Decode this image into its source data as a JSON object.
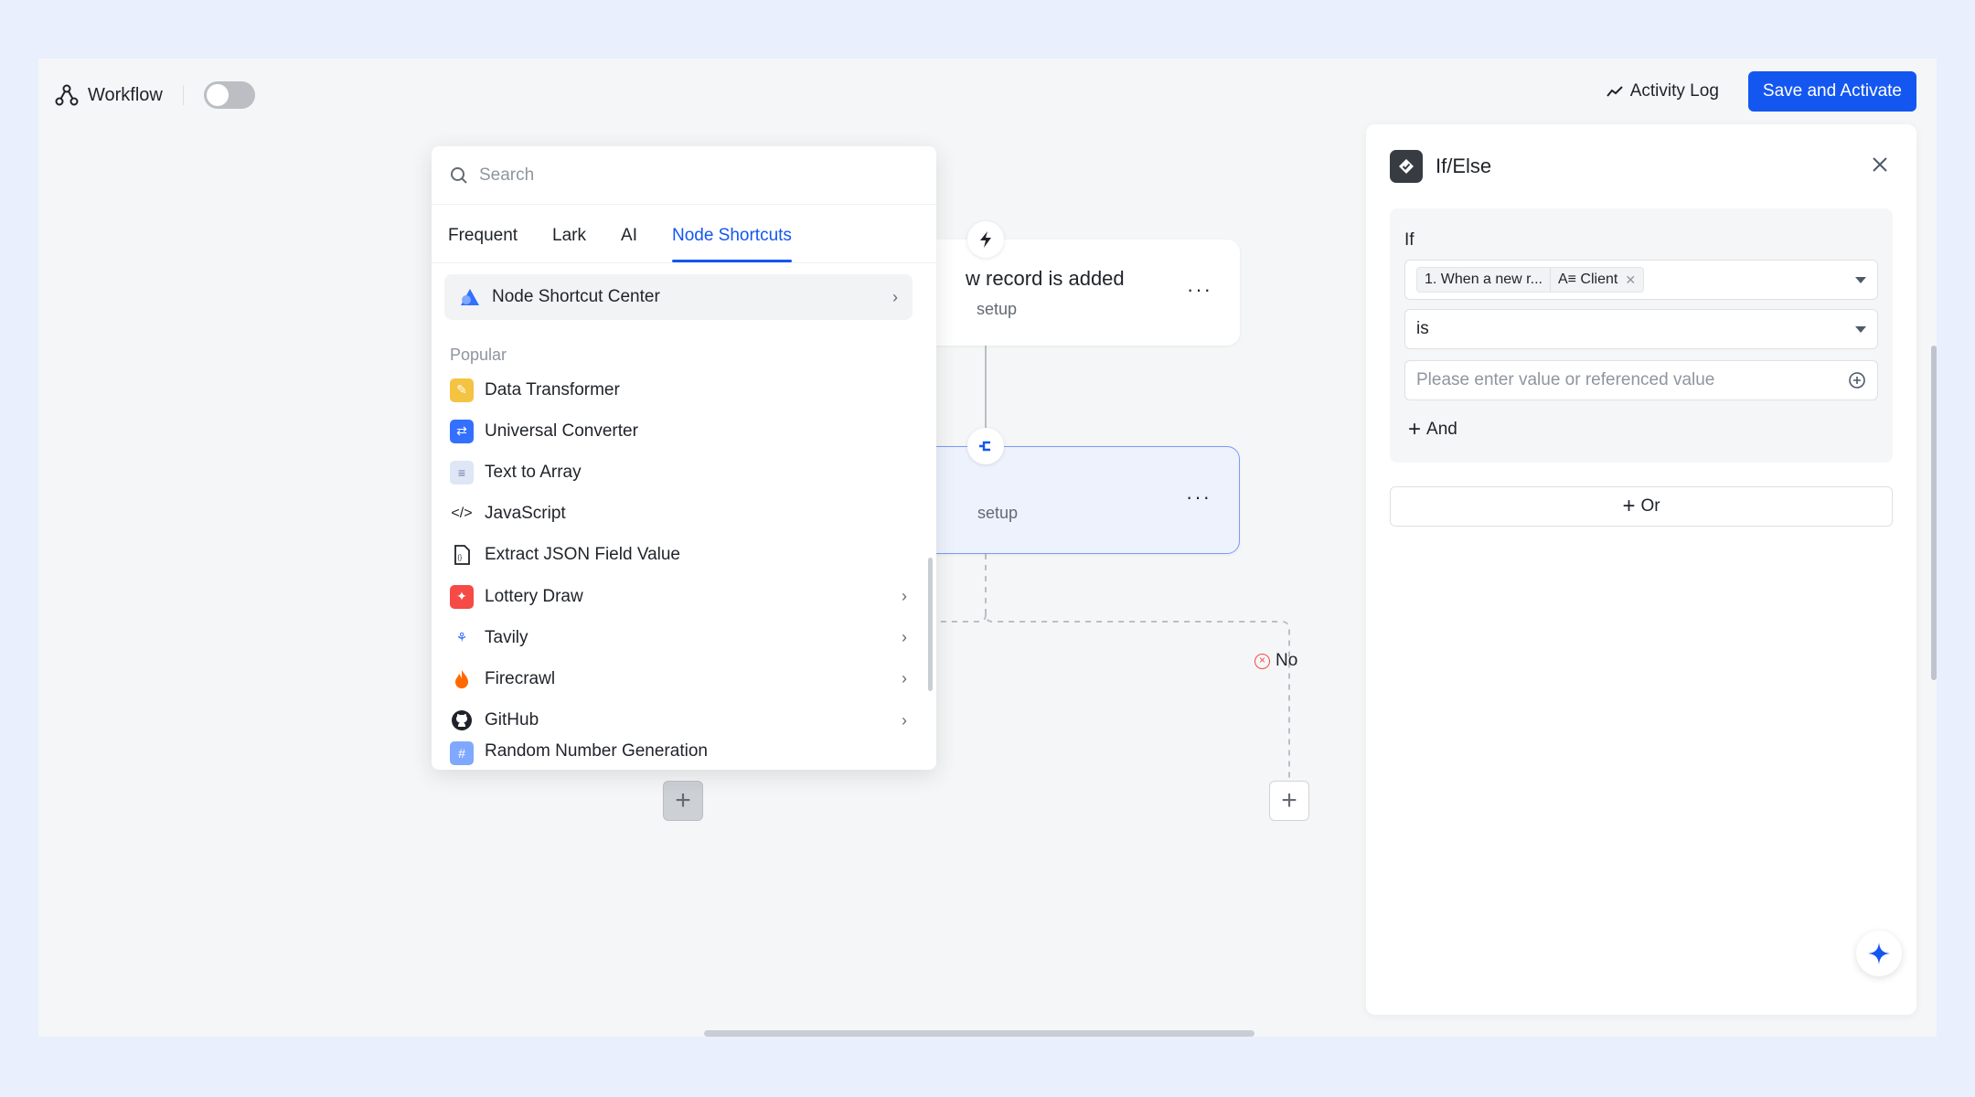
{
  "topbar": {
    "title": "Workflow",
    "activity_log": "Activity Log",
    "save_label": "Save and Activate"
  },
  "canvas": {
    "trigger_node": {
      "title": "w record is added",
      "subtitle": "setup",
      "more": "···"
    },
    "ifelse_node": {
      "subtitle": "setup",
      "more": "···"
    },
    "no_label": "No",
    "add": "+"
  },
  "picker": {
    "search_placeholder": "Search",
    "tabs": [
      "Frequent",
      "Lark",
      "AI",
      "Node Shortcuts"
    ],
    "active_tab": "Node Shortcuts",
    "shortcut_center": "Node Shortcut Center",
    "section": "Popular",
    "items": [
      {
        "label": "Data Transformer",
        "icon": "data-transformer-icon",
        "color": "#f5c342"
      },
      {
        "label": "Universal Converter",
        "icon": "universal-converter-icon",
        "color": "#3370ff"
      },
      {
        "label": "Text to Array",
        "icon": "text-to-array-icon",
        "color": "#6b7ea8"
      },
      {
        "label": "JavaScript",
        "icon": "code-icon",
        "color": "#1f2329"
      },
      {
        "label": "Extract JSON Field Value",
        "icon": "json-file-icon",
        "color": "#1f2329"
      },
      {
        "label": "Lottery Draw",
        "icon": "lottery-icon",
        "color": "#f54a45"
      },
      {
        "label": "Tavily",
        "icon": "tavily-icon",
        "color": "#3370ff"
      },
      {
        "label": "Firecrawl",
        "icon": "fire-icon",
        "color": "#ff6a00"
      },
      {
        "label": "GitHub",
        "icon": "github-icon",
        "color": "#1f2329"
      },
      {
        "label": "Random Number Generation",
        "icon": "random-number-icon",
        "color": "#3370ff"
      }
    ]
  },
  "panel": {
    "title": "If/Else",
    "if_label": "If",
    "field_tag_source": "1. When a new r...",
    "field_tag_field": "A≡ Client",
    "operator": "is",
    "value_placeholder": "Please enter value or referenced value",
    "and_label": "And",
    "or_label": "Or"
  }
}
